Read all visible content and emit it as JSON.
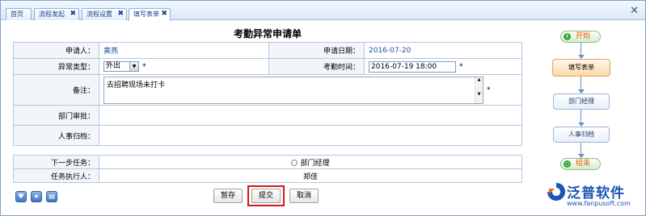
{
  "tabs": [
    {
      "label": "首页",
      "closable": false
    },
    {
      "label": "流程发起",
      "closable": true
    },
    {
      "label": "流程设置",
      "closable": true
    },
    {
      "label": "填写表单",
      "closable": true,
      "active": true
    }
  ],
  "window": {
    "close_glyph": "✕"
  },
  "form": {
    "title": "考勤异常申请单",
    "applicant_label": "申请人：",
    "applicant_value": "黄燕",
    "apply_date_label": "申请日期：",
    "apply_date_value": "2016-07-20",
    "type_label": "异常类型：",
    "type_value": "外出",
    "type_arrow": "▼",
    "time_label": "考勤时间：",
    "time_value": "2016-07-19 18:00",
    "required_mark": "*",
    "remark_label": "备注：",
    "remark_value": "去招聘现场未打卡",
    "dept_approval_label": "部门审批：",
    "hr_archive_label": "人事归档：",
    "next_task_label": "下一步任务：",
    "next_task_option": "部门经理",
    "executor_label": "任务执行人：",
    "executor_value": "郑佳"
  },
  "buttons": {
    "save": "暂存",
    "submit": "提交",
    "cancel": "取消"
  },
  "flow": {
    "start": "开始",
    "start_glyph": "!",
    "fill_form": "填写表单",
    "dept_manager": "部门经理",
    "hr_archive": "人事归档",
    "end": "结束",
    "end_glyph": "○"
  },
  "logo": {
    "name": "泛普软件",
    "url": "www.fanpusoft.com"
  },
  "colors": {
    "link_blue": "#1f55a0",
    "highlight_red": "#d0181e",
    "active_node": "#fbd9a7"
  }
}
